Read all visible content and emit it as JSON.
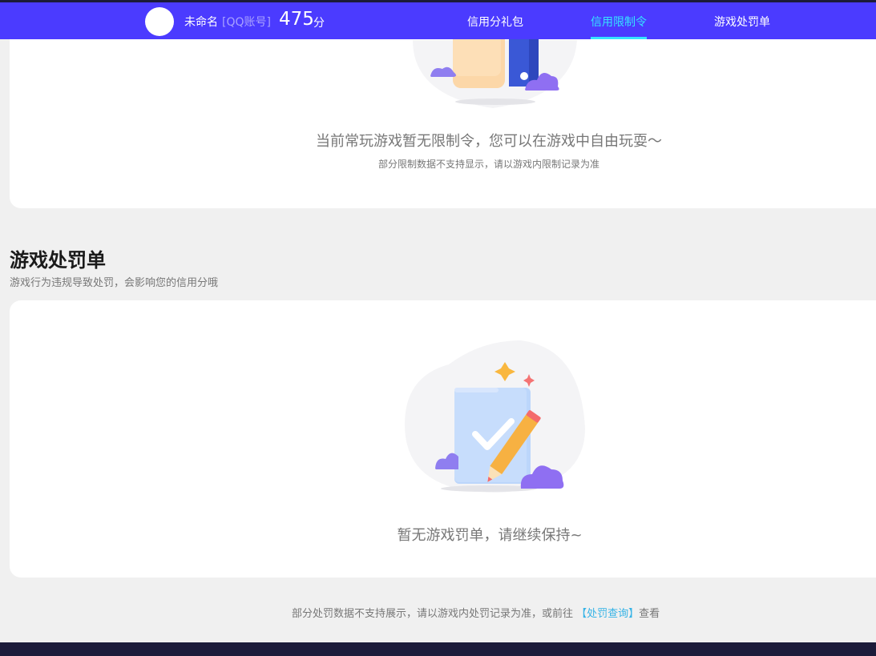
{
  "header": {
    "username": "未命名",
    "account_type": "[QQ账号]",
    "score": "475",
    "score_unit": "分",
    "nav": [
      {
        "label": "信用分礼包",
        "active": false
      },
      {
        "label": "信用限制令",
        "active": true
      },
      {
        "label": "游戏处罚单",
        "active": false
      }
    ]
  },
  "restriction": {
    "empty_message": "当前常玩游戏暂无限制令，您可以在游戏中自由玩耍～",
    "note": "部分限制数据不支持显示，请以游戏内限制记录为准"
  },
  "penalty": {
    "title": "游戏处罚单",
    "subtitle": "游戏行为违规导致处罚，会影响您的信用分哦",
    "empty_message": "暂无游戏罚单，请继续保持~"
  },
  "footer": {
    "note_prefix": "部分处罚数据不支持展示，请以游戏内处罚记录为准，或前往",
    "link_label": "【处罚查询】",
    "note_suffix": "查看"
  },
  "colors": {
    "header_bg": "#4b3bff",
    "active_nav": "#35e4ff",
    "link": "#36b3e6",
    "page_bg": "#f0f0f0"
  }
}
